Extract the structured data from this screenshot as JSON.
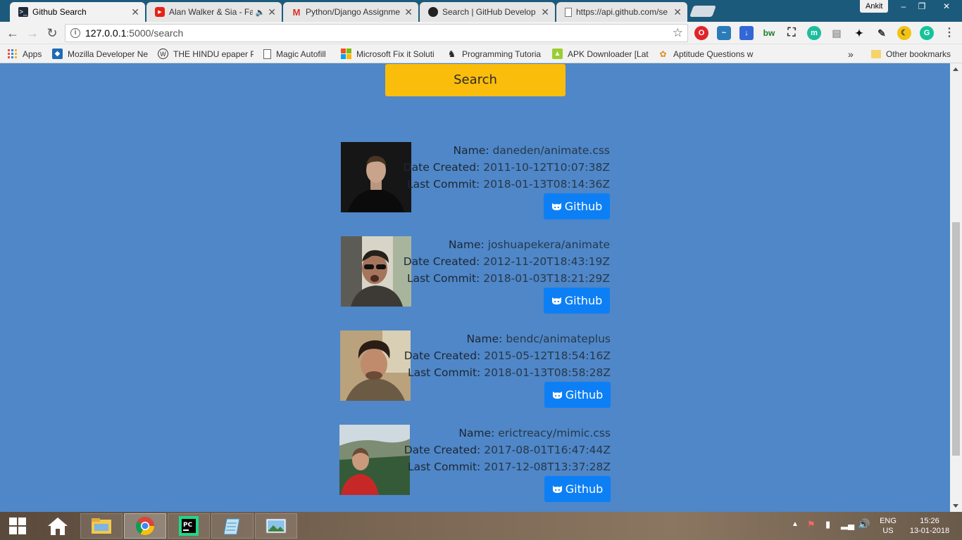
{
  "browser": {
    "tabs": [
      {
        "title": "Github Search",
        "icon": "terminal-icon",
        "active": true
      },
      {
        "title": "Alan Walker & Sia - Fa",
        "icon": "youtube-icon",
        "active": false
      },
      {
        "title": "Python/Django Assignme",
        "icon": "gmail-icon",
        "active": false
      },
      {
        "title": "Search | GitHub Develop",
        "icon": "github-icon",
        "active": false
      },
      {
        "title": "https://api.github.com/se",
        "icon": "document-icon",
        "active": false
      }
    ],
    "user": "Ankit",
    "window_buttons": {
      "minimize": "–",
      "restore": "❐",
      "close": "✕"
    },
    "url_host": "127.0.0.1",
    "url_path": ":5000/search",
    "bookmarks": [
      {
        "label": "Apps",
        "icon": "apps-grid-icon"
      },
      {
        "label": "Mozilla Developer Ne",
        "icon": "mdn-icon"
      },
      {
        "label": "THE HINDU epaper P",
        "icon": "wordpress-icon"
      },
      {
        "label": "Magic Autofill",
        "icon": "page-icon"
      },
      {
        "label": "Microsoft Fix it Soluti",
        "icon": "microsoft-icon"
      },
      {
        "label": "Programming Tutoria",
        "icon": "tutorial-icon"
      },
      {
        "label": "APK Downloader [Lat",
        "icon": "apk-icon"
      },
      {
        "label": "Aptitude Questions w",
        "icon": "aptitude-icon"
      }
    ],
    "more_bookmarks": "»",
    "other_bookmarks": "Other bookmarks"
  },
  "page": {
    "search_button": "Search",
    "labels": {
      "name": "Name:",
      "date_created": "Date Created:",
      "last_commit": "Last Commit:",
      "github_button": "Github"
    },
    "results": [
      {
        "name": "daneden/animate.css",
        "date_created": "2011-10-12T10:07:38Z",
        "last_commit": "2018-01-13T08:14:36Z"
      },
      {
        "name": "joshuapekera/animate",
        "date_created": "2012-11-20T18:43:19Z",
        "last_commit": "2018-01-03T18:21:29Z"
      },
      {
        "name": "bendc/animateplus",
        "date_created": "2015-05-12T18:54:16Z",
        "last_commit": "2018-01-13T08:58:28Z"
      },
      {
        "name": "erictreacy/mimic.css",
        "date_created": "2017-08-01T16:47:44Z",
        "last_commit": "2017-12-08T13:37:28Z"
      }
    ]
  },
  "taskbar": {
    "apps": [
      "start-icon",
      "home-icon",
      "file-explorer-icon",
      "chrome-icon",
      "pycharm-icon",
      "notepad-icon",
      "photos-icon"
    ],
    "language": "ENG",
    "region": "US",
    "time": "15:26",
    "date": "13-01-2018"
  },
  "colors": {
    "page_background": "#4f87c8",
    "search_button": "#fbbd0b",
    "github_button": "#0d7ff5"
  }
}
